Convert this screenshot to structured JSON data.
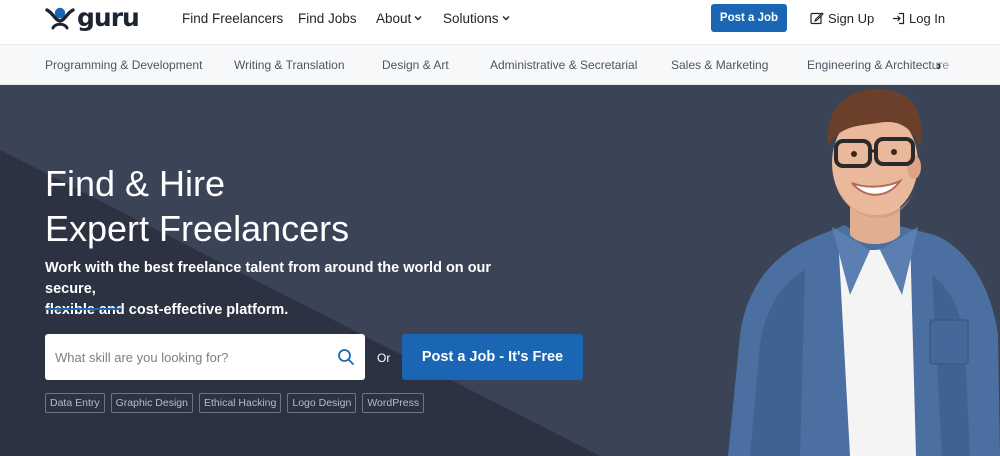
{
  "header": {
    "logo_text": "guru",
    "nav": [
      {
        "label": "Find Freelancers"
      },
      {
        "label": "Find Jobs"
      },
      {
        "label": "About"
      },
      {
        "label": "Solutions"
      }
    ],
    "chevron": "⌄",
    "post_job_label": "Post a Job",
    "sign_up_label": "Sign Up",
    "log_in_label": "Log In"
  },
  "categories": [
    "Programming & Development",
    "Writing & Translation",
    "Design & Art",
    "Administrative & Secretarial",
    "Sales & Marketing",
    "Engineering & Architecture"
  ],
  "category_next_icon": "›",
  "hero": {
    "title_line1": "Find & Hire",
    "title_line2": "Expert Freelancers",
    "subtitle_line1": "Work with the best freelance talent from around the world on our secure,",
    "subtitle_line2": "flexible and cost-effective platform.",
    "search_placeholder": "What skill are you looking for?",
    "or_label": "Or",
    "post_job_free_label": "Post a Job - It's Free",
    "tags": [
      "Data Entry",
      "Graphic Design",
      "Ethical Hacking",
      "Logo Design",
      "WordPress"
    ]
  },
  "colors": {
    "brand_blue": "#1a66b4",
    "hero_bg": "#2f3645",
    "logo_dark": "#1c2434"
  },
  "icons": {
    "logo": "guru-logo-icon",
    "sign_up": "edit-icon",
    "log_in": "login-icon",
    "search": "search-icon"
  }
}
